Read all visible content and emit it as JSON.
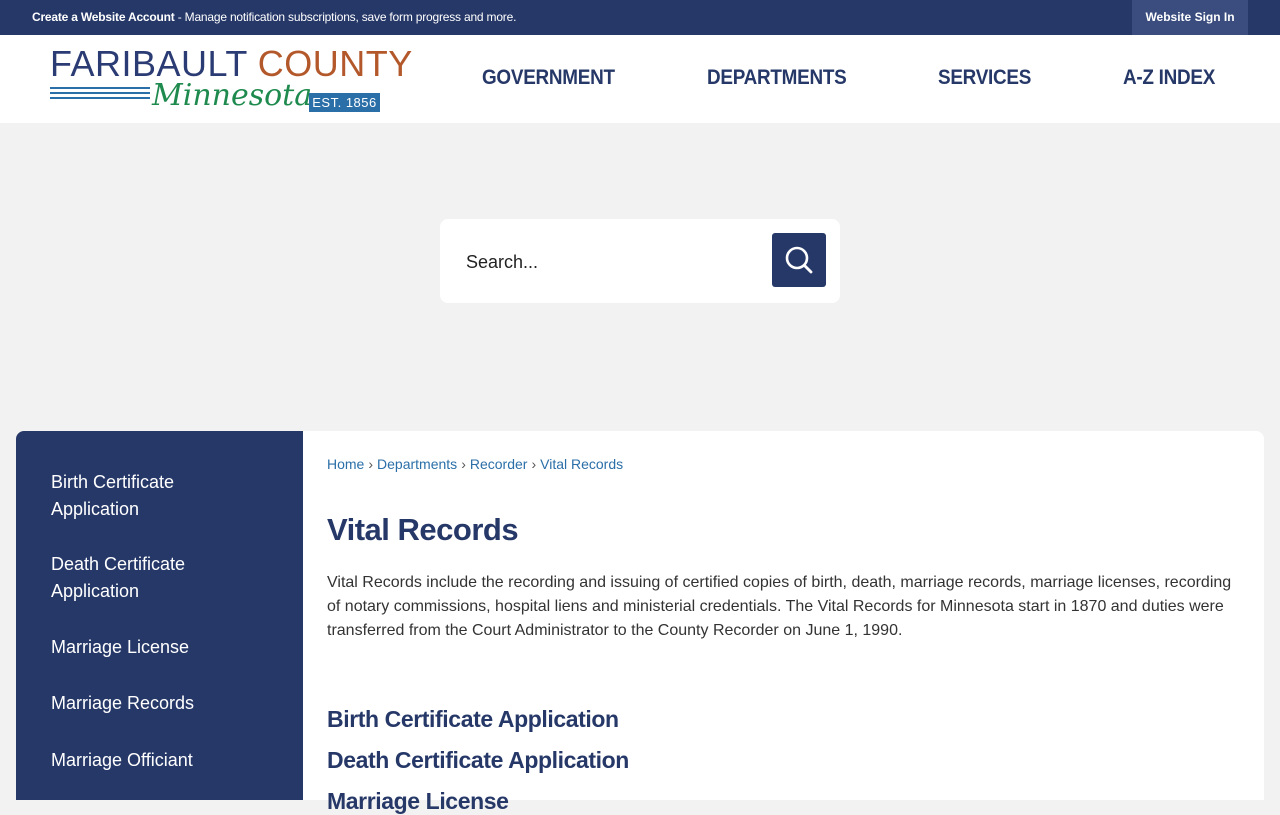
{
  "topbar": {
    "account_link": "Create a Website Account",
    "account_desc": " - Manage notification subscriptions, save form progress and more.",
    "signin": "Website Sign In"
  },
  "logo": {
    "word1": "FARIBAULT",
    "word2": "COUNTY",
    "script": "Minnesota",
    "est": "EST. 1856"
  },
  "nav": [
    {
      "label": "GOVERNMENT"
    },
    {
      "label": "DEPARTMENTS"
    },
    {
      "label": "SERVICES"
    },
    {
      "label": "A-Z INDEX"
    }
  ],
  "search": {
    "placeholder": "Search..."
  },
  "sidebar": {
    "items": [
      {
        "label": "Birth Certificate Application"
      },
      {
        "label": "Death Certificate Application"
      },
      {
        "label": "Marriage License"
      },
      {
        "label": "Marriage Records"
      },
      {
        "label": "Marriage Officiant"
      }
    ]
  },
  "breadcrumb": [
    {
      "label": "Home"
    },
    {
      "label": "Departments"
    },
    {
      "label": "Recorder"
    },
    {
      "label": "Vital Records"
    }
  ],
  "page": {
    "title": "Vital Records",
    "intro": "Vital Records include the recording and issuing of certified copies of birth, death, marriage records, marriage licenses, recording of notary commissions, hospital liens and ministerial credentials. The Vital Records for Minnesota start in 1870 and duties were transferred from the Court Administrator to the County Recorder on June 1, 1990.",
    "links": [
      {
        "label": "Birth Certificate Application"
      },
      {
        "label": "Death Certificate Application"
      },
      {
        "label": "Marriage License"
      }
    ]
  },
  "colors": {
    "brand_navy": "#263868",
    "link_blue": "#2b6fa8",
    "logo_orange": "#b3582a",
    "logo_green": "#1f8a4e"
  }
}
